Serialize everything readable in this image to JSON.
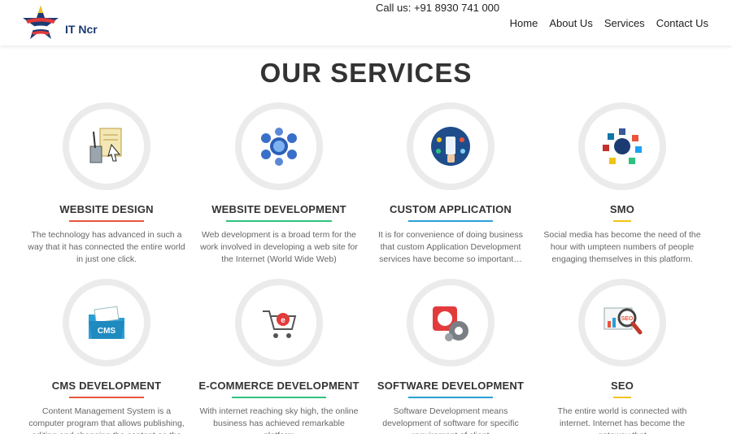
{
  "header": {
    "brand": "IT Ncr",
    "call_text": "Call us: +91 8930 741 000",
    "nav": [
      "Home",
      "About Us",
      "Services",
      "Contact Us"
    ]
  },
  "section_title": "OUR SERVICES",
  "services": [
    {
      "title": "WEBSITE DESIGN",
      "bar_color": "#e8553d",
      "icon": "design-tools-icon",
      "desc": "The technology has advanced in such a way that it has connected the entire world in just one click."
    },
    {
      "title": "WEBSITE DEVELOPMENT",
      "bar_color": "#2ec27e",
      "icon": "web-network-icon",
      "desc": "Web development is a broad term for the work involved in developing a web site for the Internet (World Wide Web)"
    },
    {
      "title": "CUSTOM APPLICATION",
      "bar_color": "#2a9fd6",
      "icon": "mobile-app-icon",
      "desc": "It is for convenience of doing business that custom Application Development services have become so important…"
    },
    {
      "title": "SMO",
      "bar_color": "#f2c414",
      "icon": "social-media-icon",
      "desc": "Social media has become the need of the hour with umpteen numbers of people engaging themselves in this platform."
    },
    {
      "title": "CMS DEVELOPMENT",
      "bar_color": "#e8553d",
      "icon": "cms-folder-icon",
      "desc": "Content Management System is a computer program that allows publishing, editing and changing the content on the"
    },
    {
      "title": "E-COMMERCE DEVELOPMENT",
      "bar_color": "#2ec27e",
      "icon": "shopping-cart-icon",
      "desc": "With internet reaching sky high, the online business has achieved remarkable platform"
    },
    {
      "title": "SOFTWARE DEVELOPMENT",
      "bar_color": "#2a9fd6",
      "icon": "software-gears-icon",
      "desc": "Software Development means development of software for specific requirement of client"
    },
    {
      "title": "SEO",
      "bar_color": "#f2c414",
      "icon": "seo-magnifier-icon",
      "desc": "The entire world is connected with internet. Internet has become the gateway that"
    }
  ]
}
